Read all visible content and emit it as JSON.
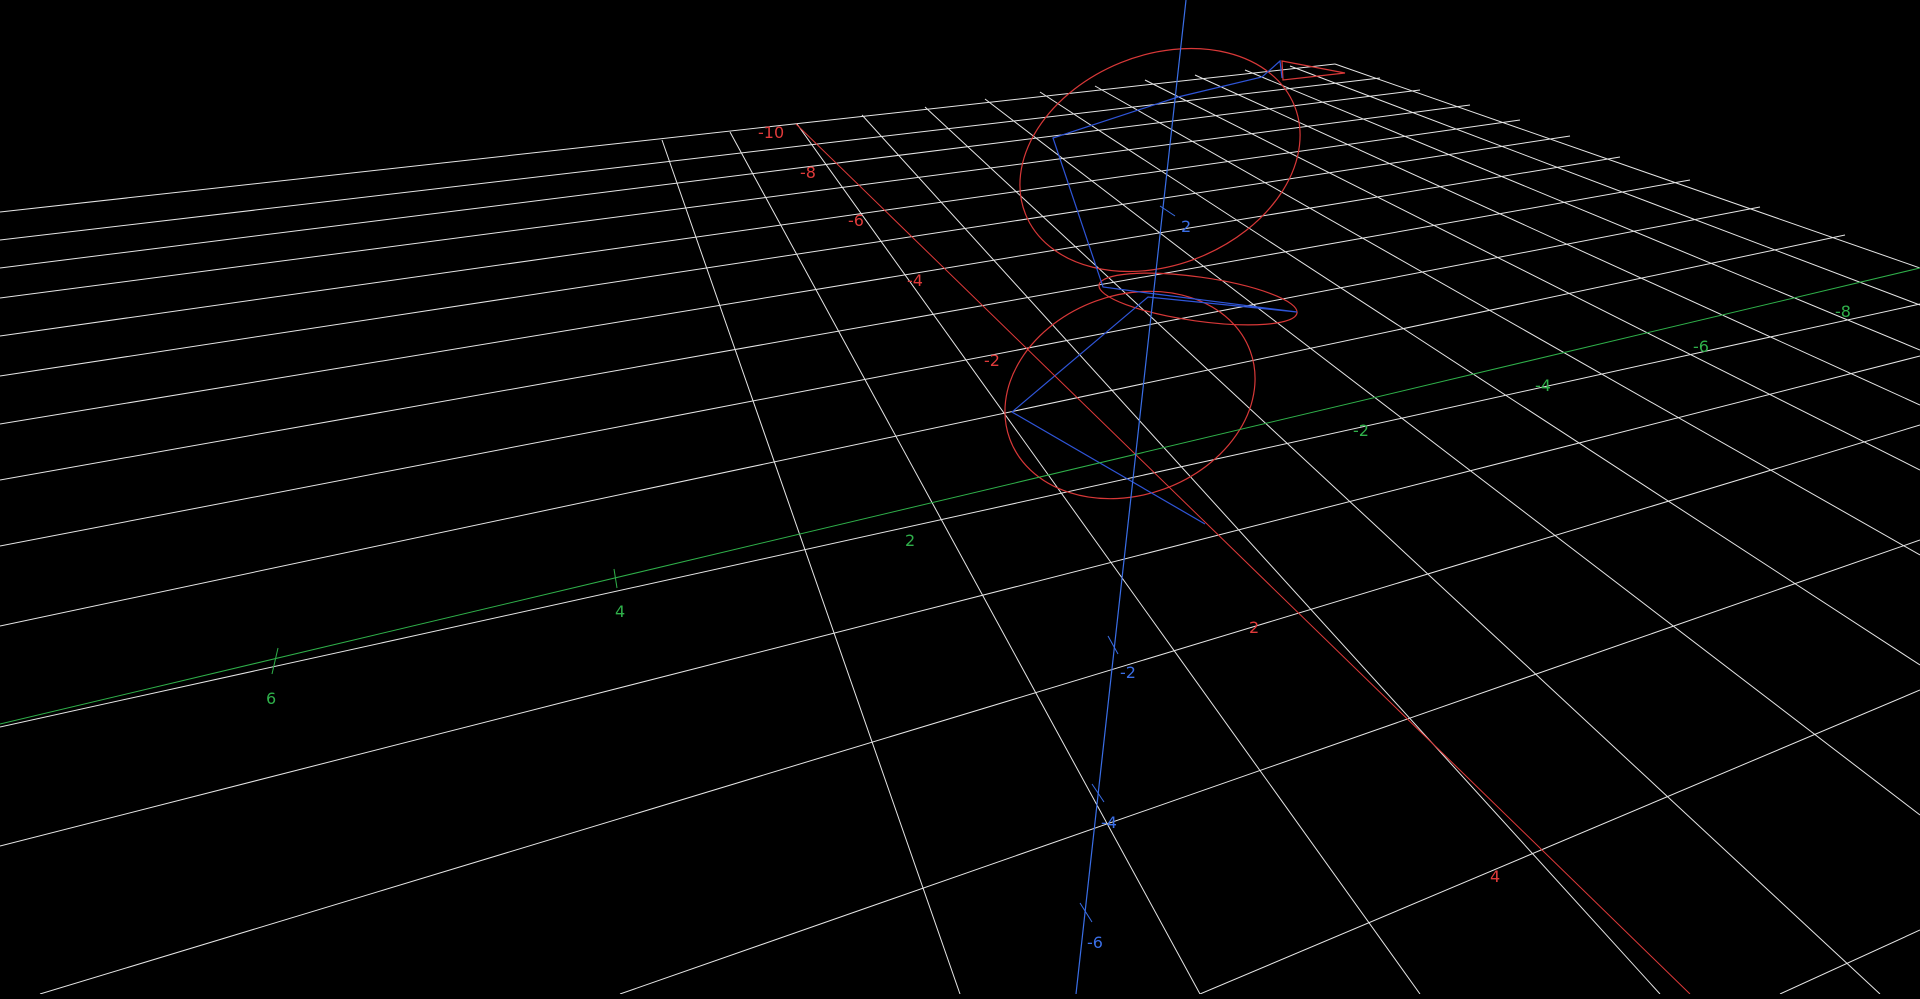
{
  "colors": {
    "background": "#000000",
    "grid": "#e6e6e6",
    "x_axis": "#e03a3a",
    "y_axis": "#2fb04a",
    "z_axis": "#3a6ee6",
    "curve_red": "#d83838",
    "curve_blue": "#2f55d8"
  },
  "axes": {
    "x": {
      "color_name": "red",
      "tick_labels": [
        "-10",
        "-8",
        "-6",
        "-4",
        "-2",
        "2",
        "4"
      ]
    },
    "y": {
      "color_name": "green",
      "tick_labels": [
        "6",
        "4",
        "2",
        "-2",
        "-4",
        "-6",
        "-8"
      ]
    },
    "z": {
      "color_name": "blue",
      "tick_labels": [
        "2",
        "-2",
        "-4",
        "-6"
      ]
    }
  },
  "scene": {
    "grid_visible": true,
    "elements": [
      "red ellipse (upper)",
      "red ellipse (lower)",
      "red ellipse (middle)",
      "blue polyline path"
    ]
  }
}
